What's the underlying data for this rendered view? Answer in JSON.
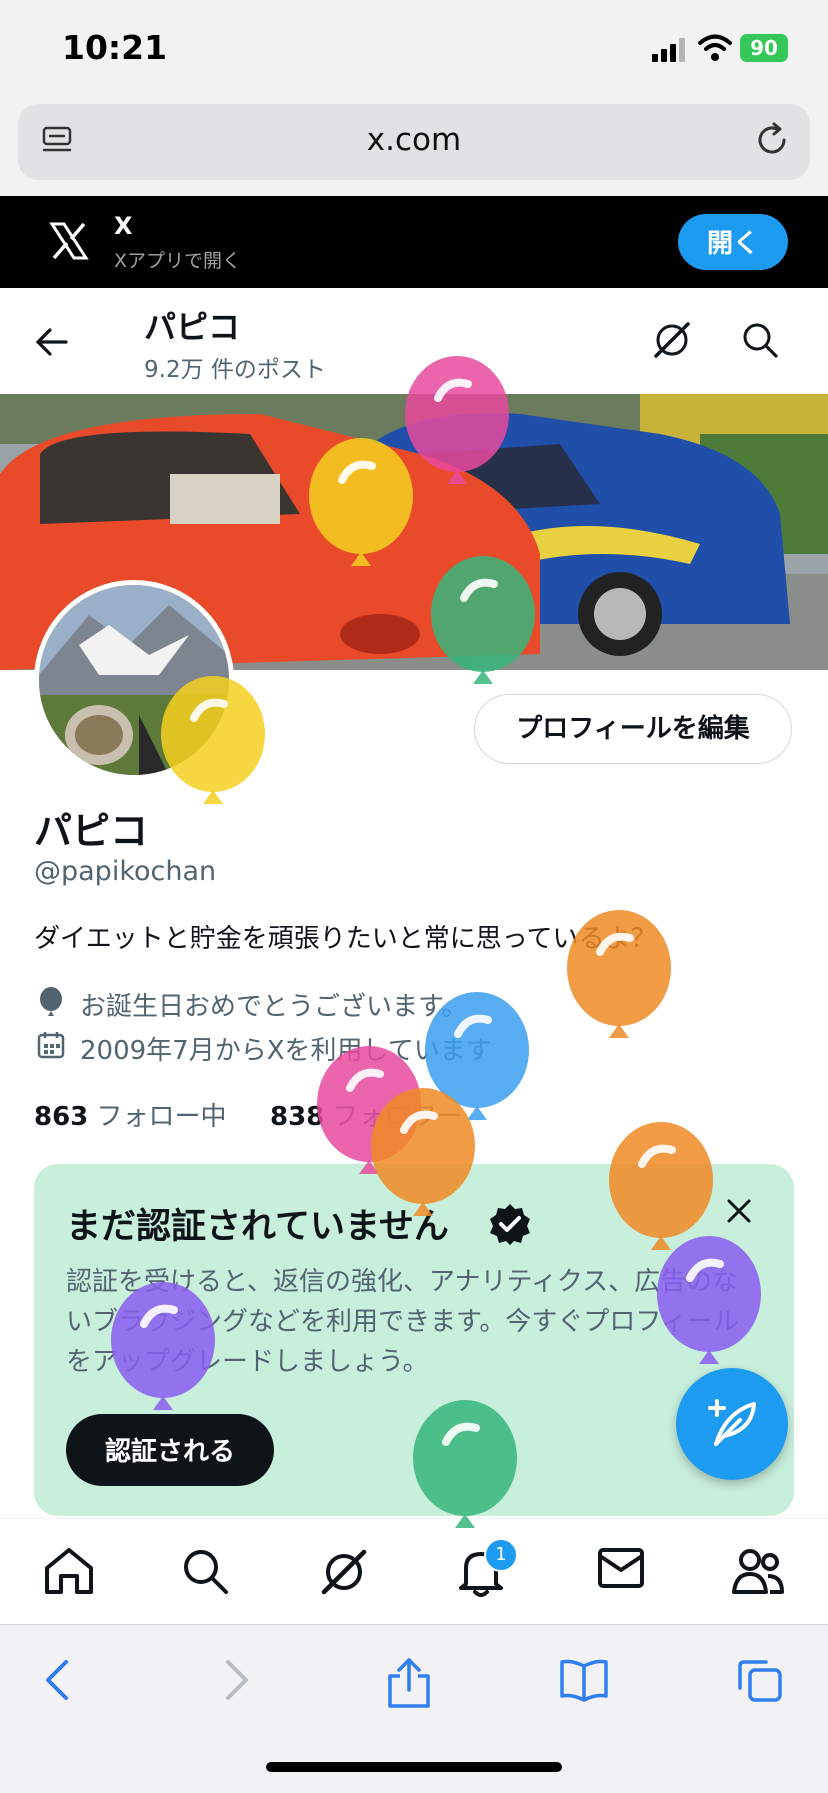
{
  "status_bar": {
    "time": "10:21",
    "battery": "90"
  },
  "browser": {
    "url": "x.com"
  },
  "app_banner": {
    "title": "X",
    "subtitle": "Xアプリで開く",
    "open_label": "開く"
  },
  "header": {
    "name": "パピコ",
    "post_count": "9.2万 件のポスト"
  },
  "profile": {
    "edit_label": "プロフィールを編集",
    "display_name": "パピコ",
    "handle": "@papikochan",
    "bio": "ダイエットと貯金を頑張りたいと常に思っているよ？",
    "birthday": "お誕生日おめでとうございます。",
    "joined": "2009年7月からXを利用しています",
    "following_count": "863",
    "following_label": "フォロー中",
    "followers_count": "838",
    "followers_label": "フォロワー"
  },
  "verify_card": {
    "title": "まだ認証されていません",
    "body": "認証を受けると、返信の強化、アナリティクス、広告のないブラウジングなどを利用できます。今すぐプロフィールをアップグレードしましょう。",
    "button": "認証される"
  },
  "bottom_nav": {
    "notification_count": "1"
  },
  "colors": {
    "accent": "#1d9bf0",
    "card_bg": "#c8efdc"
  },
  "balloon_colors": [
    "#e84a9e",
    "#f5d020",
    "#36b57a",
    "#f08a24",
    "#3a9df0",
    "#8a5df0"
  ]
}
